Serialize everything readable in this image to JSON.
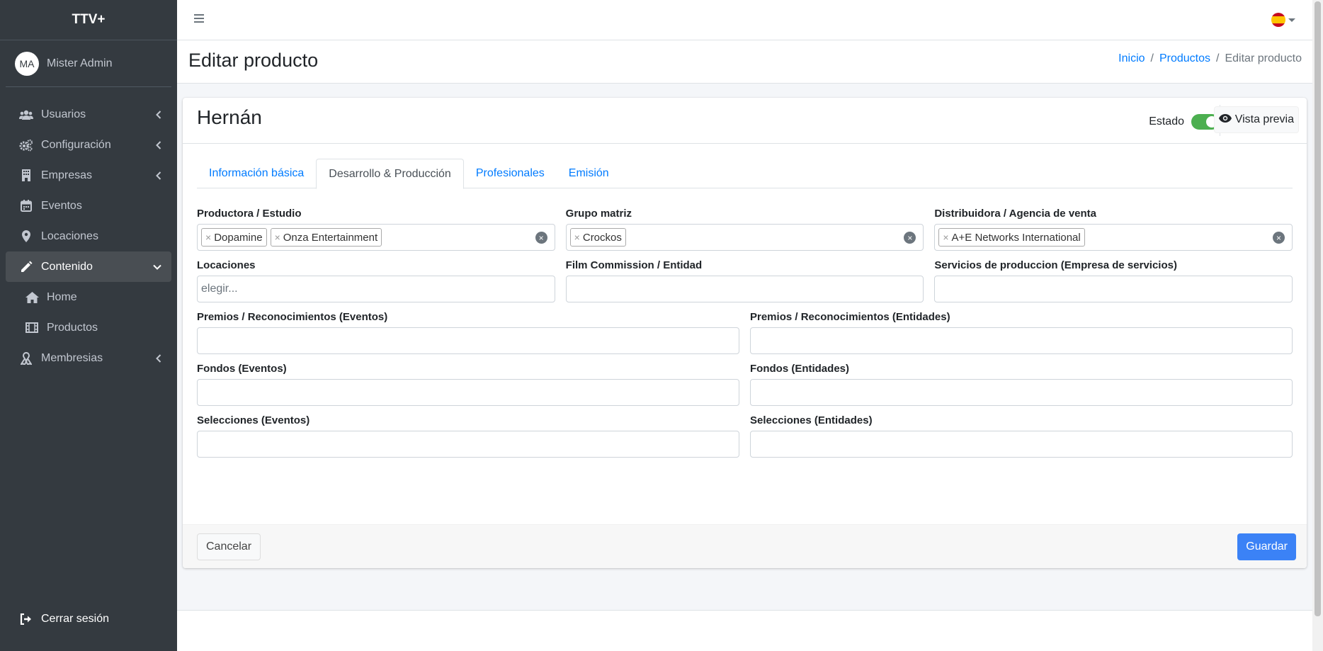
{
  "brand": "TTV+",
  "user": {
    "initials": "MA",
    "name": "Mister Admin"
  },
  "nav": [
    {
      "label": "Usuarios",
      "icon": "users-icon",
      "arrow": true
    },
    {
      "label": "Configuración",
      "icon": "cogs-icon",
      "arrow": true
    },
    {
      "label": "Empresas",
      "icon": "building-icon",
      "arrow": true
    },
    {
      "label": "Eventos",
      "icon": "calendar-icon",
      "arrow": false
    },
    {
      "label": "Locaciones",
      "icon": "map-marker-icon",
      "arrow": false
    },
    {
      "label": "Contenido",
      "icon": "pencil-icon",
      "arrow": true,
      "active": true
    },
    {
      "label": "Home",
      "icon": "home-icon",
      "sub": true
    },
    {
      "label": "Productos",
      "icon": "film-icon",
      "sub": true
    },
    {
      "label": "Membresias",
      "icon": "ribbon-icon",
      "arrow": true
    }
  ],
  "logout_label": "Cerrar sesión",
  "page_title": "Editar producto",
  "breadcrumb": {
    "home": "Inicio",
    "sep": "/",
    "products": "Productos",
    "current": "Editar producto"
  },
  "card": {
    "title": "Hernán",
    "estado_label": "Estado",
    "estado_on": true,
    "preview_label": "Vista previa"
  },
  "tabs": [
    "Información básica",
    "Desarrollo & Producción",
    "Profesionales",
    "Emisión"
  ],
  "active_tab": 1,
  "fields": {
    "productora": {
      "label": "Productora / Estudio",
      "chips": [
        "Dopamine",
        "Onza Entertainment"
      ]
    },
    "grupo": {
      "label": "Grupo matriz",
      "chips": [
        "Crockos"
      ]
    },
    "distribuidora": {
      "label": "Distribuidora / Agencia de venta",
      "chips": [
        "A+E Networks International"
      ]
    },
    "locaciones": {
      "label": "Locaciones",
      "placeholder": "elegir..."
    },
    "film_commission": {
      "label": "Film Commission / Entidad"
    },
    "servicios": {
      "label": "Servicios de produccion (Empresa de servicios)"
    },
    "premios_eventos": {
      "label": "Premios / Reconocimientos (Eventos)"
    },
    "premios_entidades": {
      "label": "Premios / Reconocimientos (Entidades)"
    },
    "fondos_eventos": {
      "label": "Fondos (Eventos)"
    },
    "fondos_entidades": {
      "label": "Fondos (Entidades)"
    },
    "selecciones_eventos": {
      "label": "Selecciones (Eventos)"
    },
    "selecciones_entidades": {
      "label": "Selecciones (Entidades)"
    }
  },
  "chip_remove": "×",
  "clear_glyph": "×",
  "buttons": {
    "cancel": "Cancelar",
    "save": "Guardar"
  },
  "colors": {
    "sidebar": "#343a40",
    "link": "#007bff",
    "toggle": "#4caf50",
    "save": "#3b82f6"
  }
}
